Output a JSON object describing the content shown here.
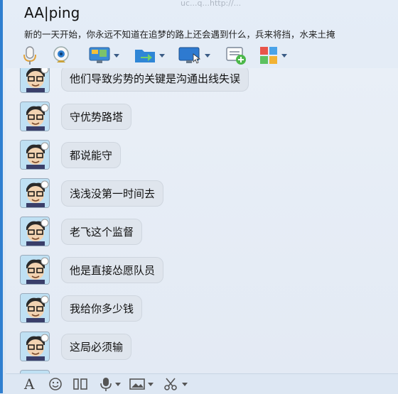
{
  "top_url_fragment": "uc...q...http://...",
  "title": "AA|ping",
  "signature": "新的一天开始，你永远不知道在追梦的路上还会遇到什么，兵来将挡，水来土掩",
  "toolbar": {
    "items": [
      {
        "icon": "microphone-icon"
      },
      {
        "icon": "camera-icon"
      },
      {
        "icon": "screen-share-icon",
        "has_dropdown": true
      },
      {
        "icon": "folder-transfer-icon",
        "has_dropdown": true
      },
      {
        "icon": "remote-desktop-icon",
        "has_dropdown": true
      },
      {
        "icon": "message-add-icon"
      },
      {
        "icon": "apps-icon",
        "has_dropdown": true
      }
    ]
  },
  "messages": [
    {
      "text": "他们导致劣势的关键是沟通出线失误"
    },
    {
      "text": "守优势路塔"
    },
    {
      "text": "都说能守"
    },
    {
      "text": "浅浅没第一时间去"
    },
    {
      "text": "老飞这个监督"
    },
    {
      "text": "他是直接怂愿队员"
    },
    {
      "text": "我给你多少钱"
    },
    {
      "text": "这局必须输"
    }
  ],
  "bottom_toolbar": {
    "font_label": "A",
    "icons": [
      "font-icon",
      "emoji-icon",
      "screenshot-icon",
      "voice-icon",
      "image-icon",
      "scissors-icon"
    ]
  },
  "colors": {
    "window_bg": "#dce6f2",
    "accent_border": "#2f7fd0",
    "bubble_bg": "#dfe5ed"
  }
}
